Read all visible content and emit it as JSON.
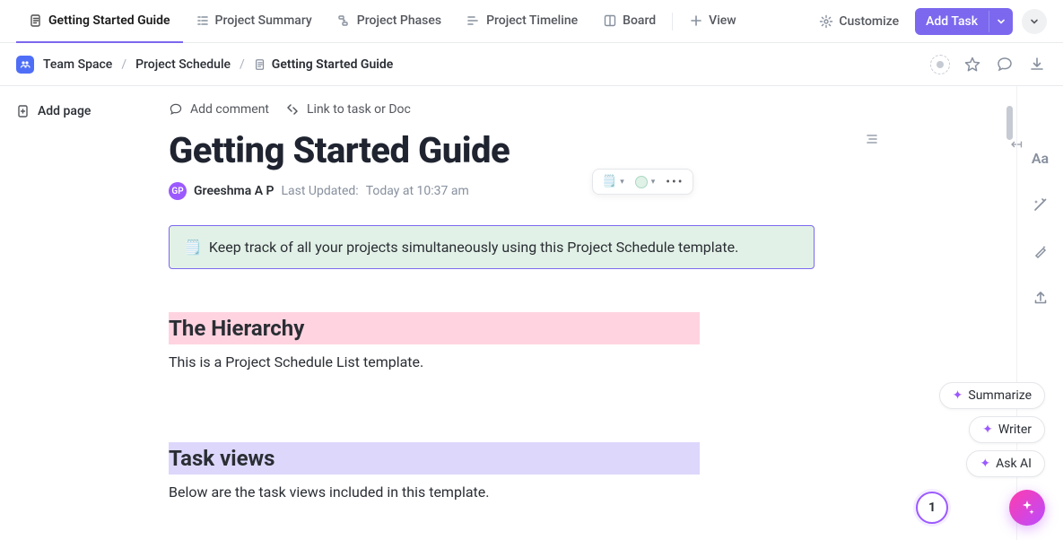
{
  "tabs": [
    {
      "label": "Getting Started Guide",
      "icon": "doc"
    },
    {
      "label": "Project Summary",
      "icon": "list"
    },
    {
      "label": "Project Phases",
      "icon": "phases"
    },
    {
      "label": "Project Timeline",
      "icon": "timeline"
    },
    {
      "label": "Board",
      "icon": "board"
    }
  ],
  "view_label": "View",
  "customize_label": "Customize",
  "add_task_label": "Add Task",
  "breadcrumb": {
    "space": "Team Space",
    "project": "Project Schedule",
    "page": "Getting Started Guide"
  },
  "left": {
    "add_page": "Add page"
  },
  "doc_tools": {
    "comment": "Add comment",
    "link": "Link to task or Doc"
  },
  "title": "Getting Started Guide",
  "author": {
    "initials": "GP",
    "name": "Greeshma A P"
  },
  "updated": {
    "label": "Last Updated:",
    "value": "Today at 10:37 am"
  },
  "callout": {
    "emoji": "🗒️",
    "text": "Keep track of all your projects simultaneously using this Project Schedule template."
  },
  "sections": {
    "hierarchy": {
      "heading": "The Hierarchy",
      "body": "This is a Project Schedule List template."
    },
    "taskviews": {
      "heading": "Task views",
      "body": "Below are the task views included in this template."
    }
  },
  "ai": {
    "summarize": "Summarize",
    "writer": "Writer",
    "ask": "Ask AI"
  },
  "badge_count": "1",
  "right_rail": {
    "aa": "Aa"
  }
}
